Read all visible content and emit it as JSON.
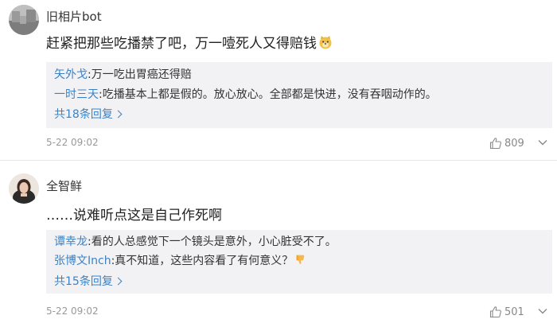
{
  "comments": [
    {
      "username": "旧相片bot",
      "content": "赶紧把那些吃播禁了吧，万一噎死人又得赔钱",
      "emoji": "doge-emoji",
      "replies": [
        {
          "user": "矢外戈",
          "text": ":万一吃出胃癌还得赔"
        },
        {
          "user": "一时三天",
          "text": ":吃播基本上都是假的。放心放心。全部都是快进，没有吞咽动作的。"
        }
      ],
      "more_replies": "共18条回复",
      "time": "5-22 09:02",
      "likes": "809"
    },
    {
      "username": "全智鲜",
      "content": "……说难听点这是自己作死啊",
      "replies": [
        {
          "user": "谭幸龙",
          "text": ":看的人总感觉下一个镜头是意外，小心脏受不了。"
        },
        {
          "user": "张博文Inch",
          "text": ":真不知道，这些内容看了有何意义？",
          "emoji": "thumbs-down-emoji"
        }
      ],
      "more_replies": "共15条回复",
      "time": "5-22 09:02",
      "likes": "501"
    }
  ],
  "colors": {
    "link_blue": "#3d82c4",
    "reply_bg": "#f2f2f5",
    "meta_gray": "#999999"
  }
}
